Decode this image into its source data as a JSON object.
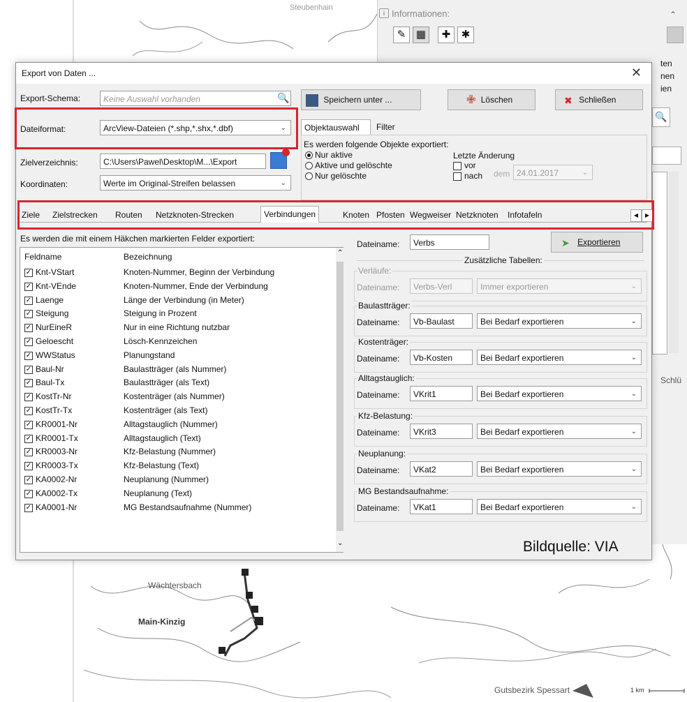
{
  "map": {
    "labels": [
      "Wächtersbach",
      "Main-Kinzig",
      "Gutsbezirk Spessart"
    ],
    "scale": "1 km",
    "partial_top_label": "Steubenhain"
  },
  "info_panel": {
    "title": "Informationen:",
    "tool_icons": [
      "pencil-icon",
      "image-icon",
      "crosshair-icon",
      "asterisk-icon"
    ]
  },
  "right_strip": {
    "labels": [
      "ten",
      "nen",
      "ien"
    ],
    "partial_button": "Schlü"
  },
  "dialog": {
    "title": "Export von Daten ...",
    "export_schema": {
      "label": "Export-Schema:",
      "placeholder": "Keine Auswahl vorhanden"
    },
    "dateiformat": {
      "label": "Dateiformat:",
      "value": "ArcView-Dateien (*.shp,*.shx,*.dbf)"
    },
    "zielverzeichnis": {
      "label": "Zielverzeichnis:",
      "value": "C:\\Users\\Pawel\\Desktop\\M...\\Export"
    },
    "koordinaten": {
      "label": "Koordinaten:",
      "value": "Werte im Original-Streifen belassen"
    },
    "buttons": {
      "save": "Speichern unter ...",
      "delete": "Löschen",
      "close": "Schließen",
      "export": "Exportieren"
    },
    "object_tabs": [
      "Objektauswahl",
      "Filter"
    ],
    "object_selection": {
      "heading": "Es werden folgende Objekte exportiert:",
      "radios": [
        {
          "label": "Nur aktive",
          "selected": true
        },
        {
          "label": "Aktive und gelöschte",
          "selected": false
        },
        {
          "label": "Nur gelöschte",
          "selected": false
        }
      ],
      "last_change": {
        "label": "Letzte Änderung",
        "vor": "vor",
        "nach": "nach",
        "dem": "dem",
        "date": "24.01.2017"
      }
    },
    "main_tabs": [
      "Ziele",
      "Zielstrecken",
      "Routen",
      "Netzknoten-Strecken",
      "Verbindungen",
      "Knoten",
      "Pfosten",
      "Wegweiser",
      "Netzknoten",
      "Infotafeln"
    ],
    "selected_tab": "Verbindungen",
    "fields_heading": "Es werden die mit einem Häkchen markierten Felder exportiert:",
    "columns": [
      "Feldname",
      "Bezeichnung"
    ],
    "fields": [
      {
        "name": "Knt-VStart",
        "desc": "Knoten-Nummer, Beginn der Verbindung",
        "checked": true
      },
      {
        "name": "Knt-VEnde",
        "desc": "Knoten-Nummer, Ende der Verbindung",
        "checked": true
      },
      {
        "name": "Laenge",
        "desc": "Länge der Verbindung (in Meter)",
        "checked": true
      },
      {
        "name": "Steigung",
        "desc": "Steigung in Prozent",
        "checked": true
      },
      {
        "name": "NurEineR",
        "desc": "Nur in eine Richtung nutzbar",
        "checked": true
      },
      {
        "name": "Geloescht",
        "desc": "Lösch-Kennzeichen",
        "checked": true
      },
      {
        "name": "WWStatus",
        "desc": "Planungstand",
        "checked": true
      },
      {
        "name": "Baul-Nr",
        "desc": "Baulastträger (als Nummer)",
        "checked": true
      },
      {
        "name": "Baul-Tx",
        "desc": "Baulastträger (als Text)",
        "checked": true
      },
      {
        "name": "KostTr-Nr",
        "desc": "Kostenträger (als Nummer)",
        "checked": true
      },
      {
        "name": "KostTr-Tx",
        "desc": "Kostenträger (als Text)",
        "checked": true
      },
      {
        "name": "KR0001-Nr",
        "desc": "Alltagstauglich (Nummer)",
        "checked": true
      },
      {
        "name": "KR0001-Tx",
        "desc": "Alltagstauglich (Text)",
        "checked": true
      },
      {
        "name": "KR0003-Nr",
        "desc": "Kfz-Belastung (Nummer)",
        "checked": true
      },
      {
        "name": "KR0003-Tx",
        "desc": "Kfz-Belastung (Text)",
        "checked": true
      },
      {
        "name": "KA0002-Nr",
        "desc": "Neuplanung (Nummer)",
        "checked": true
      },
      {
        "name": "KA0002-Tx",
        "desc": "Neuplanung (Text)",
        "checked": true
      },
      {
        "name": "KA0001-Nr",
        "desc": "MG Bestandsaufnahme (Nummer)",
        "checked": true
      }
    ],
    "dateiname_label": "Dateiname:",
    "main_filename": "Verbs",
    "extra_tables_heading": "Zusätzliche Tabellen:",
    "extra_tables": [
      {
        "group": "Verläufe:",
        "filename": "Verbs-Verl",
        "option": "Immer exportieren",
        "disabled": true
      },
      {
        "group": "Baulastträger:",
        "filename": "Vb-Baulast",
        "option": "Bei Bedarf exportieren",
        "disabled": false
      },
      {
        "group": "Kostenträger:",
        "filename": "Vb-Kosten",
        "option": "Bei Bedarf exportieren",
        "disabled": false
      },
      {
        "group": "Alltagstauglich:",
        "filename": "VKrit1",
        "option": "Bei Bedarf exportieren",
        "disabled": false
      },
      {
        "group": "Kfz-Belastung:",
        "filename": "VKrit3",
        "option": "Bei Bedarf exportieren",
        "disabled": false
      },
      {
        "group": "Neuplanung:",
        "filename": "VKat2",
        "option": "Bei Bedarf exportieren",
        "disabled": false
      },
      {
        "group": "MG Bestandsaufnahme:",
        "filename": "VKat1",
        "option": "Bei Bedarf exportieren",
        "disabled": false
      }
    ],
    "source_credit": "Bildquelle: VIA"
  },
  "colors": {
    "highlight": "#d8262e",
    "dialog_bg": "#f0f0f0"
  }
}
